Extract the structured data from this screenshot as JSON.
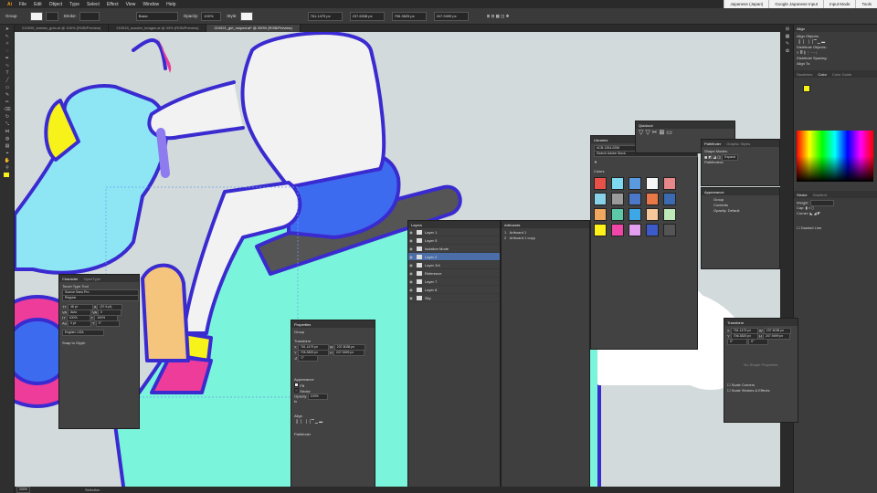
{
  "menu": [
    "Ai",
    "File",
    "Edit",
    "Object",
    "Type",
    "Select",
    "Effect",
    "View",
    "Window",
    "Help"
  ],
  "ime": [
    "Japanese (Japan)",
    "Google Japanese Input",
    "Input Mode",
    "Tools"
  ],
  "control_bar": {
    "group_label": "Group",
    "stroke_label": "Stroke:",
    "basic_label": "Basic",
    "opacity_label": "Opacity:",
    "opacity_value": "100%",
    "style_label": "Style:",
    "x_value": "761.1479 px",
    "y_value": "706.3825 px",
    "w_value": "237.6038 px",
    "h_value": "247.9499 px"
  },
  "doc_tabs": [
    "210920_tomato_goto.ai @ 100% (RGB/Preview)",
    "210915_scooter_images.ai @ 33% (RGB/Preview)",
    "210921_girl_moped.ai* @ 200% (RGB/Preview)"
  ],
  "character_panel": {
    "tabs": [
      "Character",
      "OpenType"
    ],
    "touch_type": "Touch Type Tool",
    "font": "Source Sans Pro",
    "style": "Regular",
    "size": "48 pt",
    "leading": "(57.6 pt)",
    "tracking": "Auto",
    "kern": "0",
    "scale_v": "100%",
    "scale_h": "100%",
    "baseline": "0 pt",
    "rotate": "0°",
    "language": "English: USA",
    "snap": "Snap to Glyph"
  },
  "properties_panel": {
    "title": "Properties",
    "group": "Group",
    "transform": "Transform",
    "x": "761.1479 px",
    "y": "706.3825 px",
    "w": "237.6038 px",
    "h": "247.9499 px",
    "angle": "0°",
    "appearance": "Appearance",
    "fill": "Fill",
    "stroke": "Stroke",
    "opacity_label": "Opacity",
    "opacity": "100%",
    "fx": "fx",
    "align": "Align",
    "pathfinder": "Pathfinder"
  },
  "layers_panel": {
    "title": "Layers",
    "rows": [
      "Layer 1",
      "Layer 5",
      "Isolation Mode",
      "Layer 2",
      "Layer 3/4",
      "Reference",
      "Layer 7",
      "Layer 8",
      "Sky"
    ],
    "selected_index": 3
  },
  "artboards_panel": {
    "title": "Artboards",
    "rows": [
      {
        "n": "1",
        "name": "Artboard 1"
      },
      {
        "n": "2",
        "name": "Artboard 1 copy"
      }
    ]
  },
  "libraries_panel": {
    "title": "Libraries",
    "library": "ACB-1354-0256",
    "search": "Search Adobe Stock",
    "colors_label": "Colors",
    "colors": [
      "#e8504a",
      "#7dd8f0",
      "#5a9be0",
      "#f6f6f6",
      "#e8878a",
      "#88d2e8",
      "#9a9a9a",
      "#4b78c8",
      "#e87848",
      "#3c6ab0",
      "#f0a860",
      "#5cc8a8",
      "#3ca8e8",
      "#f8c89a",
      "#bde8b8",
      "#fff21a",
      "#f046a8",
      "#e49ef0",
      "#3c5ac8",
      "#555555"
    ]
  },
  "quickcut_panel": {
    "title": "Quickcut"
  },
  "pathfinder_panel": {
    "tabs": [
      "Pathfinder",
      "Graphic Styles"
    ],
    "shape_modes": "Shape Modes:",
    "pathfinders": "Pathfinders:",
    "expand": "Expand"
  },
  "appearance_panel": {
    "title": "Appearance",
    "group": "Group",
    "contents": "Contents",
    "opacity": "Opacity: Default"
  },
  "transform_panel": {
    "title": "Transform",
    "x": "761.1479 px",
    "y": "706.3825 px",
    "w": "237.6038 px",
    "h": "247.9499 px",
    "angle": "0°",
    "shear": "0°",
    "no_appearance": "No Shape Properties",
    "scale_corners": "Scale Corners",
    "scale_strokes": "Scale Strokes & Effects"
  },
  "right_dock": {
    "align_title": "Align",
    "align_objects": "Align Objects:",
    "distribute_objects": "Distribute Objects:",
    "distribute_spacing": "Distribute Spacing:",
    "align_to": "Align To:",
    "tabs": [
      "Swatches",
      "Color",
      "Color Guide"
    ],
    "stroke_tabs": [
      "Stroke",
      "Gradient"
    ],
    "weight": "Weight:",
    "cap": "Cap:",
    "corner": "Corner:",
    "dashed": "Dashed Line"
  },
  "status": {
    "zoom": "200%",
    "tool": "Selection"
  },
  "colors": {
    "outline": "#3a2bd0",
    "cyan": "#8ee6f5",
    "mint": "#7af4da",
    "pink": "#ee3c9a",
    "yellow": "#f6f21a",
    "blue": "#3d6bf0",
    "purple": "#8f7bf0",
    "canvas": "#d3dadb"
  }
}
